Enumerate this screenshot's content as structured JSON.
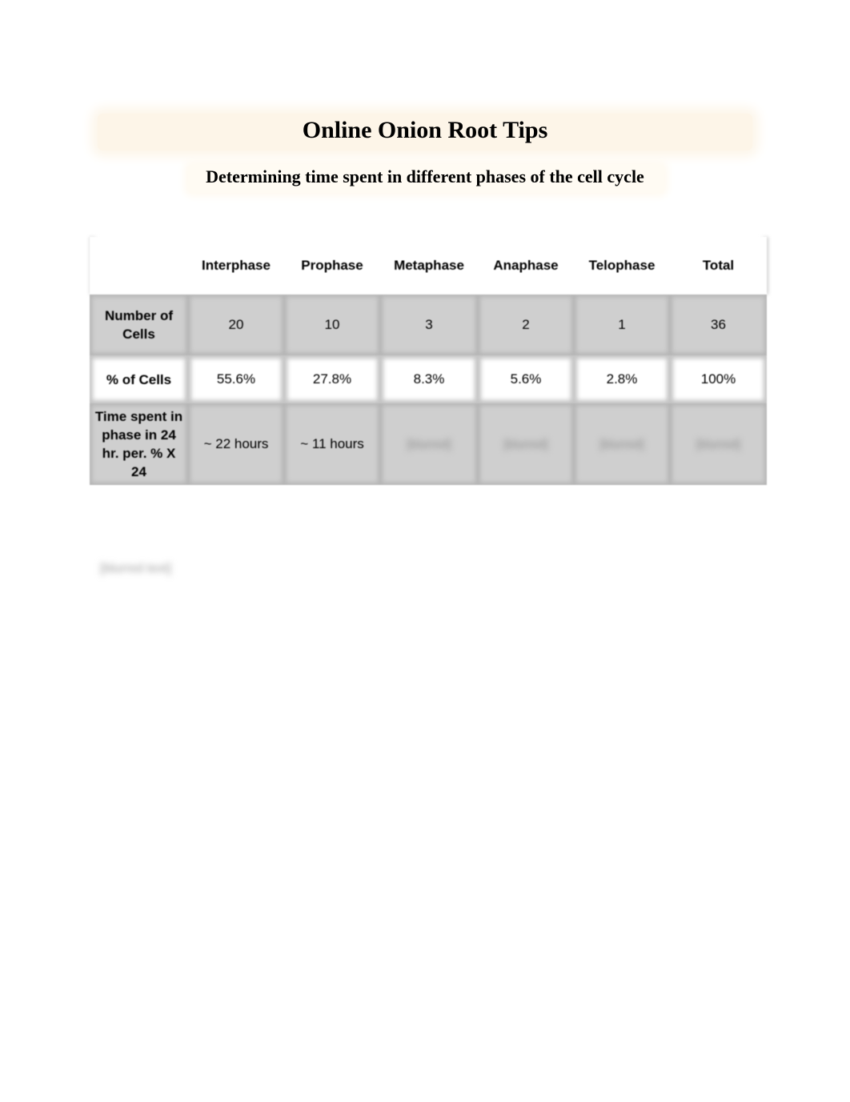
{
  "document": {
    "title": "Online Onion Root Tips",
    "subtitle": "Determining time spent in different phases of the cell cycle"
  },
  "table": {
    "columns": [
      "",
      "Interphase",
      "Prophase",
      "Metaphase",
      "Anaphase",
      "Telophase",
      "Total"
    ],
    "rows": [
      {
        "label": "Number of Cells",
        "values": [
          "20",
          "10",
          "3",
          "2",
          "1",
          "36"
        ]
      },
      {
        "label": "% of Cells",
        "values": [
          "55.6%",
          "27.8%",
          "8.3%",
          "5.6%",
          "2.8%",
          "100%"
        ]
      },
      {
        "label": "Time spent in phase in 24 hr. per. % X 24",
        "values": [
          "~ 22 hours",
          "~ 11 hours",
          "[blurred]",
          "[blurred]",
          "[blurred]",
          "[blurred]"
        ]
      }
    ]
  },
  "paragraph": {
    "text": "[blurred text]"
  },
  "colors": {
    "title_band": "#fdf5e8",
    "gray_row": "#cfcfcf",
    "white_row": "#ffffff"
  }
}
